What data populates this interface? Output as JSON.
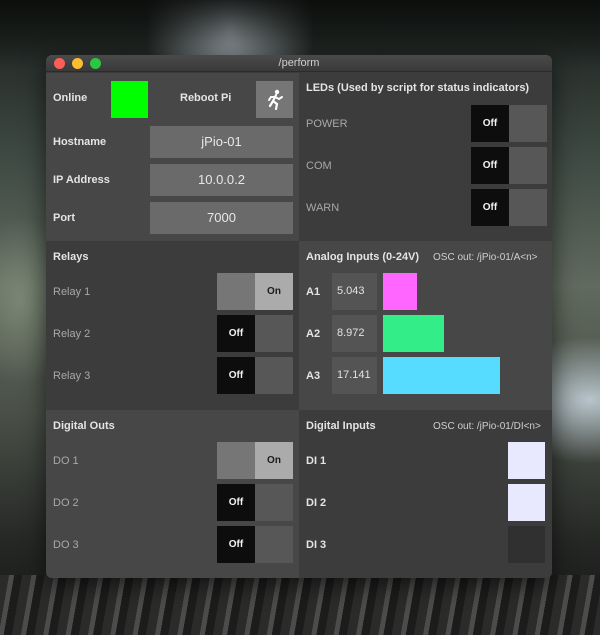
{
  "window": {
    "title": "/perform"
  },
  "colors": {
    "online": "#00ff00",
    "a1": "#ff66ff",
    "a2": "#33ee88",
    "a3": "#55dcff",
    "di_on": "#e8e8ff",
    "di_off": "#303030"
  },
  "status": {
    "online_label": "Online",
    "reboot_label": "Reboot Pi",
    "reboot_icon": "running-person-icon",
    "hostname_label": "Hostname",
    "hostname_value": "jPio-01",
    "ip_label": "IP Address",
    "ip_value": "10.0.0.2",
    "port_label": "Port",
    "port_value": "7000"
  },
  "leds": {
    "header": "LEDs  (Used by script for status indicators)",
    "items": [
      {
        "label": "POWER",
        "state": "Off"
      },
      {
        "label": "COM",
        "state": "Off"
      },
      {
        "label": "WARN",
        "state": "Off"
      }
    ]
  },
  "relays": {
    "header": "Relays",
    "items": [
      {
        "label": "Relay 1",
        "state": "On"
      },
      {
        "label": "Relay 2",
        "state": "Off"
      },
      {
        "label": "Relay 3",
        "state": "Off"
      }
    ]
  },
  "analog": {
    "header": "Analog Inputs (0-24V)",
    "osc": "OSC out: /jPio-01/A<n>",
    "max": 24,
    "items": [
      {
        "label": "A1",
        "value": "5.043"
      },
      {
        "label": "A2",
        "value": "8.972"
      },
      {
        "label": "A3",
        "value": "17.141"
      }
    ]
  },
  "digital_outs": {
    "header": "Digital Outs",
    "items": [
      {
        "label": "DO 1",
        "state": "On"
      },
      {
        "label": "DO 2",
        "state": "Off"
      },
      {
        "label": "DO 3",
        "state": "Off"
      }
    ]
  },
  "digital_inputs": {
    "header": "Digital Inputs",
    "osc": "OSC out: /jPio-01/DI<n>",
    "items": [
      {
        "label": "DI 1",
        "active": true
      },
      {
        "label": "DI 2",
        "active": true
      },
      {
        "label": "DI 3",
        "active": false
      }
    ]
  }
}
